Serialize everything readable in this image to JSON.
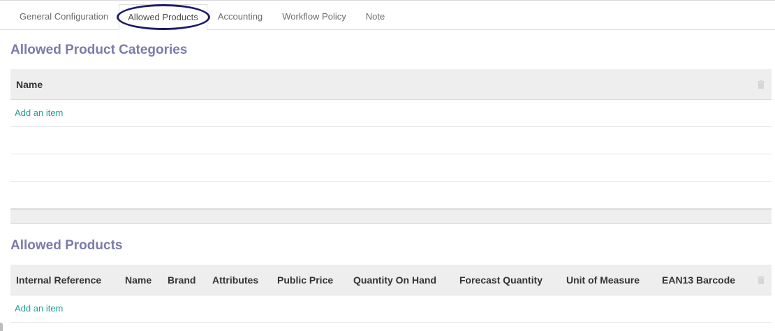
{
  "tabs": [
    {
      "label": "General Configuration"
    },
    {
      "label": "Allowed Products",
      "active": true
    },
    {
      "label": "Accounting"
    },
    {
      "label": "Workflow Policy"
    },
    {
      "label": "Note"
    }
  ],
  "categories_section": {
    "title": "Allowed Product Categories",
    "columns": [
      "Name"
    ],
    "add_item_label": "Add an item"
  },
  "products_section": {
    "title": "Allowed Products",
    "columns": [
      "Internal Reference",
      "Name",
      "Brand",
      "Attributes",
      "Public Price",
      "Quantity On Hand",
      "Forecast Quantity",
      "Unit of Measure",
      "EAN13 Barcode"
    ],
    "add_item_label": "Add an item"
  },
  "colors": {
    "section_title": "#7c7bad",
    "link": "#21a091",
    "annotation": "#1d1b6b"
  },
  "icons": {
    "delete_column": "trash-icon"
  }
}
